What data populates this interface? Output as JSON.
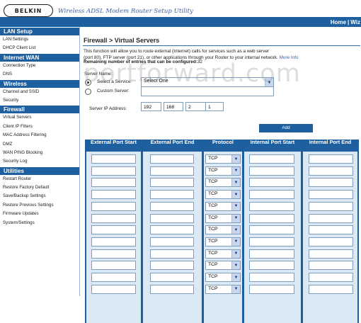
{
  "header": {
    "logo_text": "BELKIN",
    "app_title": "Wireless ADSL Modem Router Setup Utility",
    "nav": [
      "Home",
      "|",
      "Wiz"
    ]
  },
  "sidebar": {
    "sections": [
      {
        "title": "LAN Setup",
        "items": [
          "LAN Settings",
          "DHCP Client List"
        ]
      },
      {
        "title": "Internet WAN",
        "items": [
          "Connection Type",
          "DNS"
        ]
      },
      {
        "title": "Wireless",
        "items": [
          "Channel and SSID",
          "Security"
        ]
      },
      {
        "title": "Firewall",
        "items": [
          "Virtual Servers",
          "Client IP Filters",
          "MAC Address Filtering",
          "DMZ",
          "WAN PING Blocking",
          "Security Log"
        ]
      },
      {
        "title": "Utilities",
        "items": [
          "Restart Router",
          "Restore Factory Default",
          "Save/Backup Settings",
          "Restore Previous Settings",
          "Firmware Updates",
          "System/Settings"
        ]
      }
    ]
  },
  "main": {
    "page_title": "Firewall > Virtual Servers",
    "desc_line1": "This function will allow you to route external (Internet) calls for services such as a web server",
    "desc_line2": "(port 80), FTP server (port 21), or other applications through your Router to your internal network.",
    "more_info": "More Info",
    "remaining_label": "Remaining number of entries that can be configured:",
    "remaining_value": "32",
    "server_name_label": "Server Name:",
    "select_service_label": "Select a Service:",
    "select_service_value": "Select One",
    "custom_server_label": "Custom Server:",
    "custom_server_value": "",
    "server_ip_label": "Server IP Address:",
    "ip": [
      "192",
      "168",
      "2",
      "1"
    ],
    "add_label": "Add",
    "table": {
      "headers": [
        "External Port Start",
        "External Port End",
        "Protocol",
        "Internal Port Start",
        "Internal Port End"
      ],
      "rows": [
        {
          "protocol": "TCP"
        },
        {
          "protocol": "TCP"
        },
        {
          "protocol": "TCP"
        },
        {
          "protocol": "TCP"
        },
        {
          "protocol": "TCP"
        },
        {
          "protocol": "TCP"
        },
        {
          "protocol": "TCP"
        },
        {
          "protocol": "TCP"
        },
        {
          "protocol": "TCP"
        },
        {
          "protocol": "TCP"
        },
        {
          "protocol": "TCP"
        },
        {
          "protocol": "TCP"
        }
      ]
    }
  },
  "watermark": "portforward.com",
  "colors": {
    "brand_blue": "#1e5f9f",
    "cell_bg": "#dbe8f5",
    "title_blue": "#3f63a8"
  }
}
